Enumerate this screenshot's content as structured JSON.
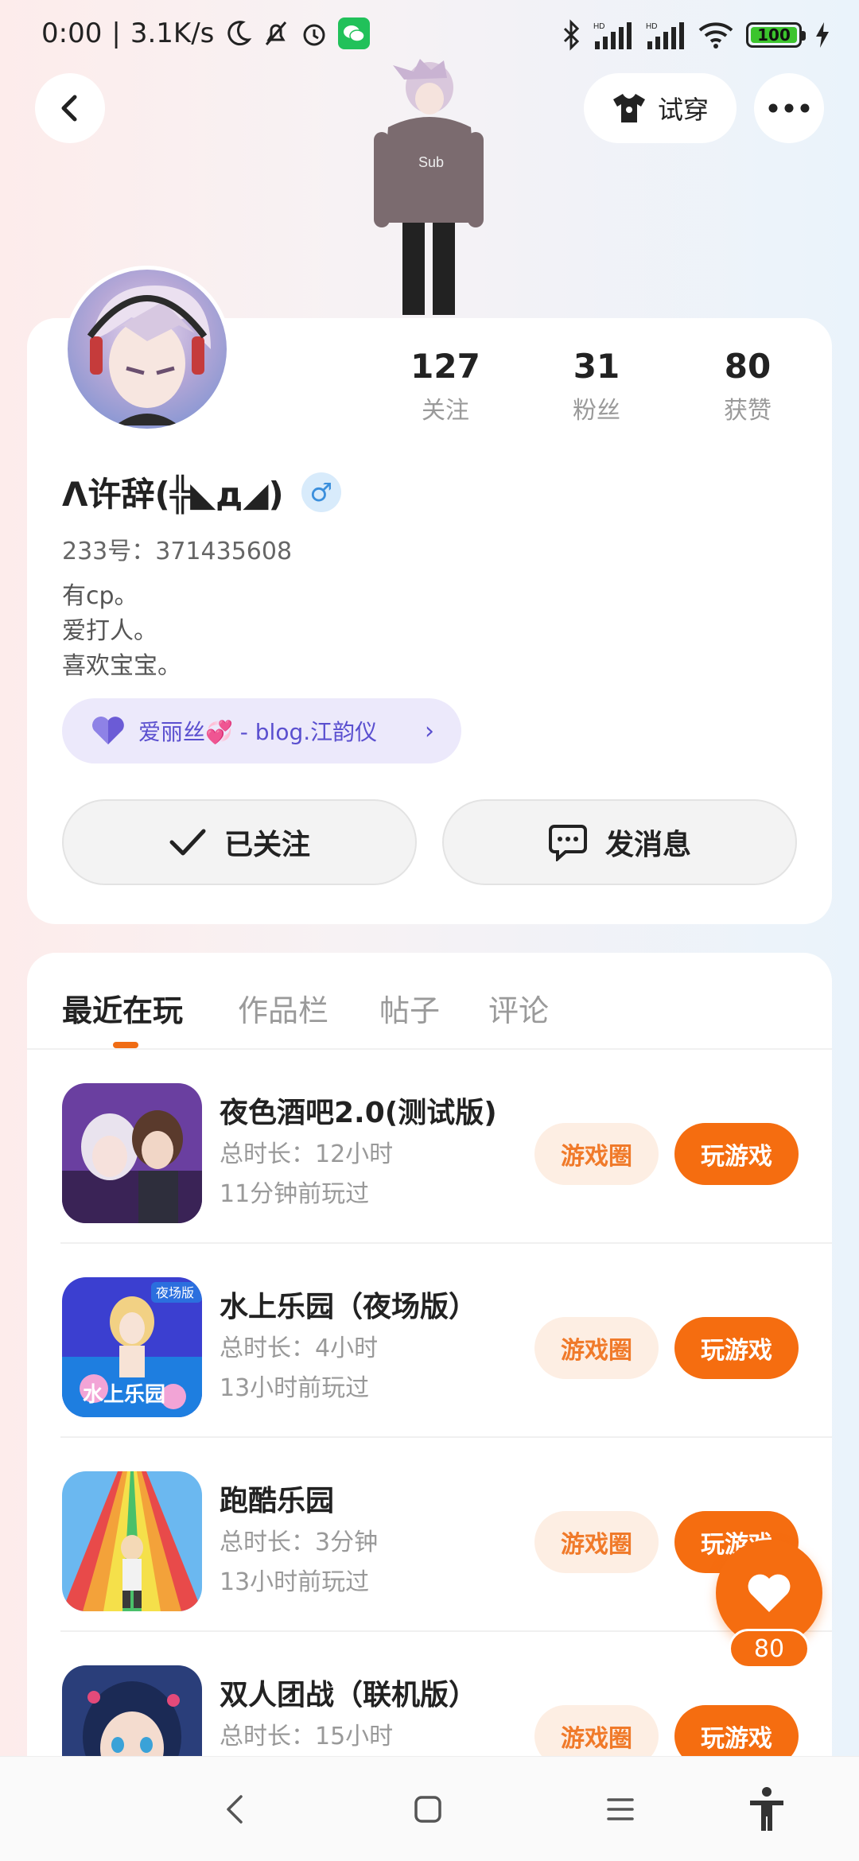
{
  "status_bar": {
    "time": "0:00",
    "network_speed": "3.1K/s",
    "battery_level": "100",
    "battery_percent": 100,
    "icons": [
      "moon-icon",
      "bell-off-icon",
      "alarm-icon",
      "wechat-icon",
      "bluetooth-icon",
      "signal-icon",
      "signal-icon",
      "wifi-icon",
      "battery-icon",
      "charging-icon"
    ]
  },
  "header": {
    "try_on_label": "试穿"
  },
  "profile": {
    "stats": [
      {
        "value": "127",
        "label": "关注"
      },
      {
        "value": "31",
        "label": "粉丝"
      },
      {
        "value": "80",
        "label": "获赞"
      }
    ],
    "username": "Λ许辞(╬◣д◢)",
    "gender_symbol": "♂",
    "user_id": "233号：371435608",
    "bio": [
      "有cp。",
      "爱打人。",
      "喜欢宝宝。"
    ],
    "club_label": "爱丽丝💞 - blog.江韵仪",
    "follow_label": "已关注",
    "message_label": "发消息"
  },
  "tabs": [
    "最近在玩",
    "作品栏",
    "帖子",
    "评论"
  ],
  "games": [
    {
      "title": "夜色酒吧2.0(测试版)",
      "duration": "总时长：12小时",
      "last_played": "11分钟前玩过",
      "circle_label": "游戏圈",
      "play_label": "玩游戏"
    },
    {
      "title": "水上乐园（夜场版）",
      "duration": "总时长：4小时",
      "last_played": "13小时前玩过",
      "circle_label": "游戏圈",
      "play_label": "玩游戏",
      "icon_text": "水上乐园",
      "icon_badge": "夜场版"
    },
    {
      "title": "跑酷乐园",
      "duration": "总时长：3分钟",
      "last_played": "13小时前玩过",
      "circle_label": "游戏圈",
      "play_label": "玩游戏"
    },
    {
      "title": "双人团战（联机版）",
      "duration": "总时长：15小时",
      "last_played": "",
      "circle_label": "游戏圈",
      "play_label": "玩游戏"
    }
  ],
  "floating_like": {
    "count": "80"
  },
  "colors": {
    "accent": "#f56d10",
    "accent_light": "#fdeee3",
    "club_purple": "#5a4fcf"
  }
}
